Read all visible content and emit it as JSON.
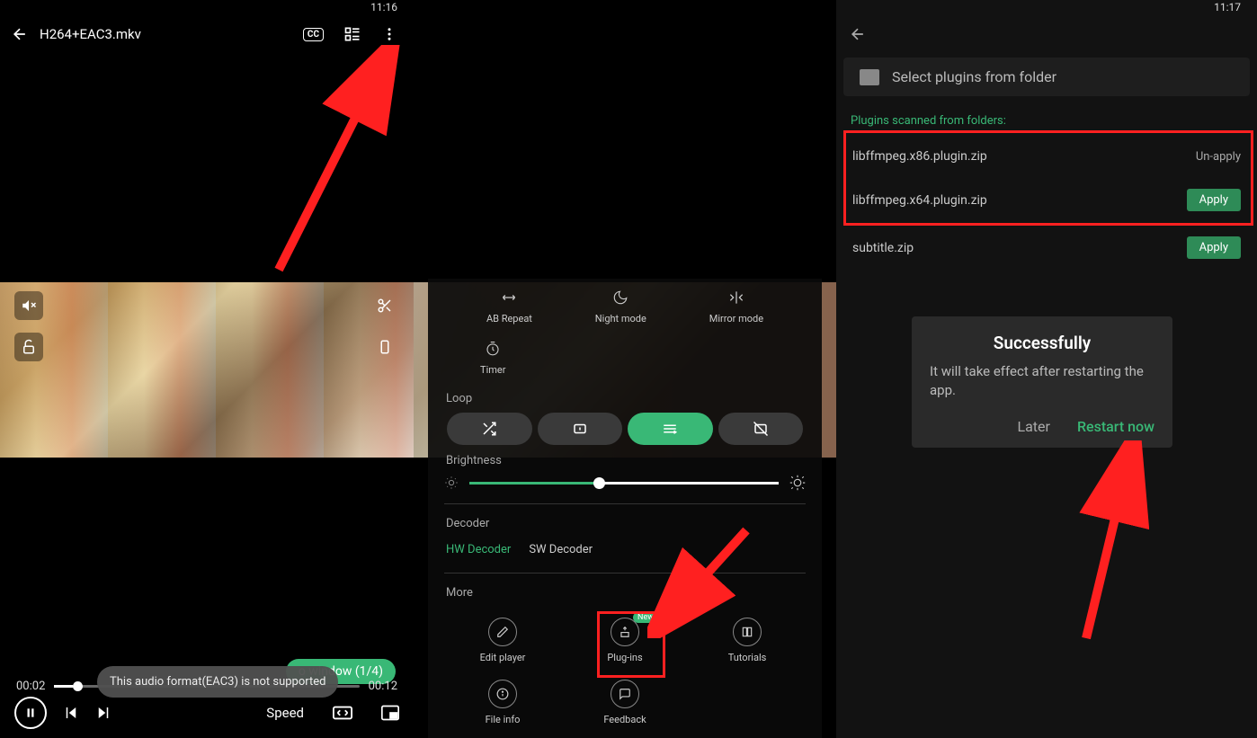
{
  "panel1": {
    "status_time": "11:16",
    "title": "H264+EAC3.mkv",
    "window_pill": "o window (1/4)",
    "toast": "This audio format(EAC3) is not supported",
    "time_current": "00:02",
    "time_total": "00:12",
    "speed_label": "Speed"
  },
  "panel2": {
    "modes": {
      "ab": "AB Repeat",
      "night": "Night mode",
      "mirror": "Mirror mode",
      "timer": "Timer"
    },
    "loop_label": "Loop",
    "brightness_label": "Brightness",
    "decoder_label": "Decoder",
    "hw_decoder": "HW Decoder",
    "sw_decoder": "SW Decoder",
    "more_label": "More",
    "more": {
      "edit": "Edit player",
      "plugins": "Plug-ins",
      "tutorials": "Tutorials",
      "fileinfo": "File info",
      "feedback": "Feedback"
    },
    "new_badge": "New"
  },
  "panel3": {
    "status_time": "11:17",
    "select_folder": "Select plugins from folder",
    "scanned_label": "Plugins scanned from folders:",
    "plugins": {
      "p1": "libffmpeg.x86.plugin.zip",
      "p1_action": "Un-apply",
      "p2": "libffmpeg.x64.plugin.zip",
      "p2_action": "Apply",
      "p3": "subtitle.zip",
      "p3_action": "Apply"
    },
    "dialog": {
      "title": "Successfully",
      "body": "It will take effect after restarting the app.",
      "later": "Later",
      "restart": "Restart now"
    }
  }
}
